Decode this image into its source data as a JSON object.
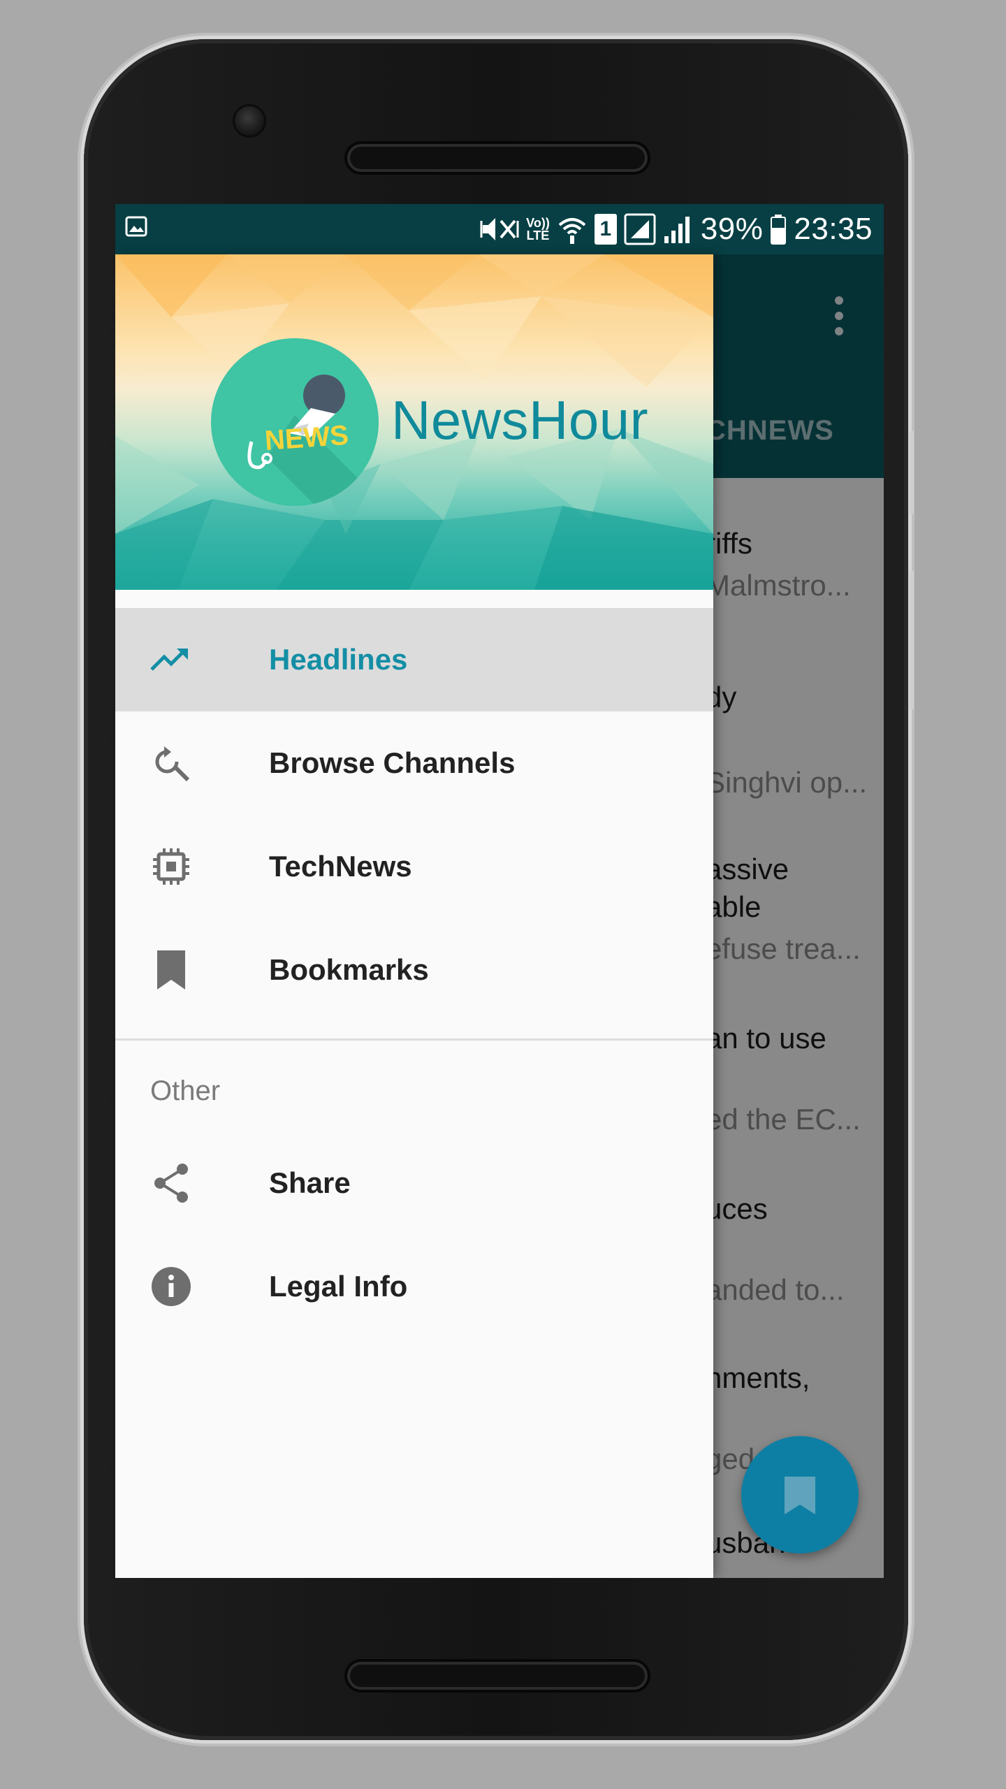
{
  "status_bar": {
    "battery": "39%",
    "time": "23:35",
    "sim_slot": "1",
    "network_label_top": "Vo))",
    "network_label_bottom": "LTE"
  },
  "app_bar": {
    "tab_partial": "CHNEWS"
  },
  "background_articles": [
    {
      "title": "riffs",
      "subtitle": "Malmstro..."
    },
    {
      "title": "dy",
      "subtitle": "Singhvi op..."
    },
    {
      "title": "assive",
      "title2": "able",
      "subtitle": "efuse trea..."
    },
    {
      "title": "an to use",
      "subtitle": "ed the EC..."
    },
    {
      "title": "uces",
      "subtitle": "anded to..."
    },
    {
      "title": "nments,",
      "subtitle": "ged"
    },
    {
      "title": "usband"
    }
  ],
  "drawer": {
    "header": {
      "app_name": "NewsHour",
      "logo_text": "NEWS"
    },
    "items": [
      {
        "label": "Headlines",
        "icon": "trending-up-icon",
        "active": true
      },
      {
        "label": "Browse Channels",
        "icon": "search-refresh-icon",
        "active": false
      },
      {
        "label": "TechNews",
        "icon": "chip-icon",
        "active": false
      },
      {
        "label": "Bookmarks",
        "icon": "bookmark-icon",
        "active": false
      }
    ],
    "section_title": "Other",
    "other_items": [
      {
        "label": "Share",
        "icon": "share-icon"
      },
      {
        "label": "Legal Info",
        "icon": "info-icon"
      }
    ]
  },
  "colors": {
    "status_bar": "#073f44",
    "app_bar": "#0a5962",
    "accent": "#138ea5",
    "fab": "#0e7fa4",
    "title": "#0f8a9b"
  }
}
